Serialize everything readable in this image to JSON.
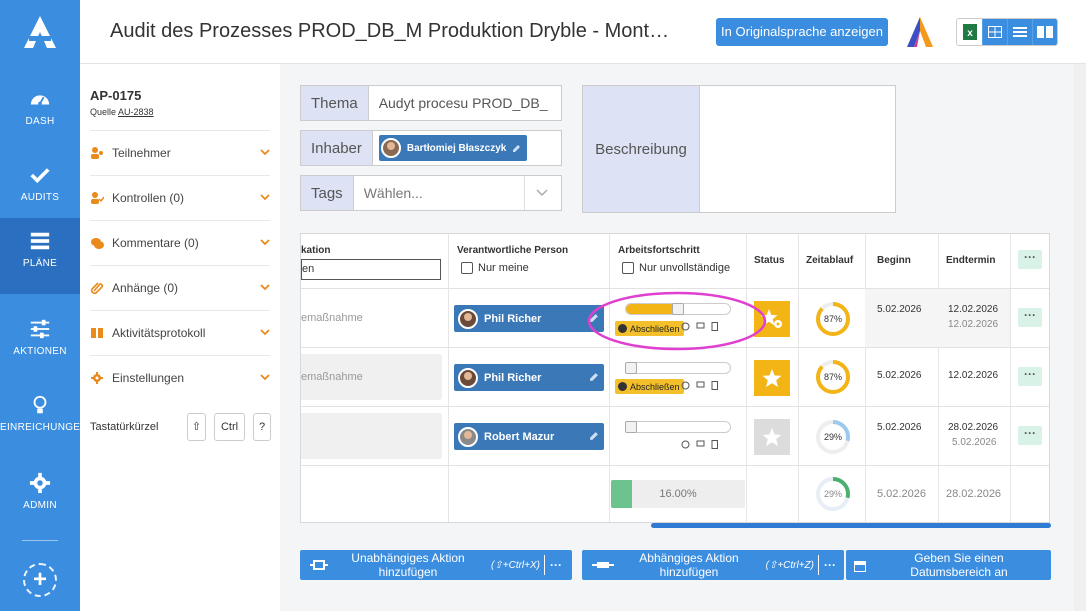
{
  "nav": {
    "items": [
      {
        "label": "DASH",
        "icon": "gauge-icon"
      },
      {
        "label": "AUDITS",
        "icon": "check-icon"
      },
      {
        "label": "PLÄNE",
        "icon": "layers-icon",
        "active": true
      },
      {
        "label": "AKTIONEN",
        "icon": "sliders-icon"
      },
      {
        "label": "EINREICHUNGEN",
        "icon": "lightbulb-icon"
      },
      {
        "label": "ADMIN",
        "icon": "gear-icon"
      }
    ],
    "add": "+"
  },
  "header": {
    "title": "Audit des Prozesses PROD_DB_M Produktion Dryble - Mont…",
    "original_lang_button": "In Originalsprache anzeigen"
  },
  "sidebar": {
    "code": "AP-0175",
    "source_label": "Quelle",
    "source_link": "AU-2838",
    "sections": [
      {
        "label": "Teilnehmer",
        "icon": "users-icon"
      },
      {
        "label": "Kontrollen (0)",
        "icon": "user-check-icon"
      },
      {
        "label": "Kommentare (0)",
        "icon": "comments-icon"
      },
      {
        "label": "Anhänge (0)",
        "icon": "paperclip-icon"
      },
      {
        "label": "Aktivitätsprotokoll",
        "icon": "book-icon"
      },
      {
        "label": "Einstellungen",
        "icon": "gear-icon"
      }
    ],
    "shortcuts_label": "Tastatürkürzel",
    "shortcut_keys": [
      "⇧",
      "Ctrl",
      "?"
    ]
  },
  "form": {
    "theme_label": "Thema",
    "theme_value": "Audyt procesu PROD_DB_",
    "owner_label": "Inhaber",
    "owner_value": "Bartłomiej Błaszczyk",
    "tags_label": "Tags",
    "tags_placeholder": "Wählen...",
    "description_label": "Beschreibung"
  },
  "table": {
    "headers": {
      "action": "kation",
      "person": "Verantwortliche Person",
      "progress": "Arbeitsfortschritt",
      "status": "Status",
      "timeline": "Zeitablauf",
      "begin": "Beginn",
      "end": "Endtermin",
      "more": "···"
    },
    "filter_value": "en",
    "only_mine": "Nur meine",
    "only_incomplete": "Nur unvollständige",
    "rows": [
      {
        "action": "emaßnahme",
        "person": "Phil Richer",
        "progress": 0.55,
        "finish": "Abschließen",
        "status": "gear-star",
        "status_color": "#f3b416",
        "timeline_pct": 87,
        "timeline_label": "87%",
        "begin": "5.02.2026",
        "end": "12.02.2026",
        "end2": "12.02.2026"
      },
      {
        "action": "emaßnahme",
        "person": "Phil Richer",
        "progress": 0.0,
        "finish": "Abschließen",
        "status": "star",
        "status_color": "#f3b416",
        "timeline_pct": 87,
        "timeline_label": "87%",
        "begin": "5.02.2026",
        "end": "12.02.2026",
        "end2": ""
      },
      {
        "action": "",
        "person": "Robert Mazur",
        "progress": 0.0,
        "finish": "",
        "status": "star",
        "status_color": "#d8d8d8",
        "timeline_pct": 29,
        "timeline_label": "29%",
        "begin": "5.02.2026",
        "end": "28.02.2026",
        "end2": "5.02.2026"
      }
    ],
    "totals": {
      "progress_label": "16.00%",
      "progress": 0.16,
      "timeline_pct": 29,
      "timeline_label": "29%",
      "begin": "5.02.2026",
      "end": "28.02.2026"
    }
  },
  "buttons": [
    {
      "label": "Unabhängiges Aktion hinzufügen",
      "shortcut": "(⇧+Ctrl+X)",
      "more": "···"
    },
    {
      "label": "Abhängiges Aktion hinzufügen",
      "shortcut": "(⇧+Ctrl+Z)",
      "more": "···"
    },
    {
      "label": "Geben Sie einen Datumsbereich an"
    }
  ],
  "colors": {
    "accent": "#3b8de0",
    "warning": "#f3b416",
    "annotation": "#e040d0",
    "ring_yellow": "#f3b416",
    "ring_blue": "#9ec9ef",
    "ring_green": "#4caf6e"
  }
}
